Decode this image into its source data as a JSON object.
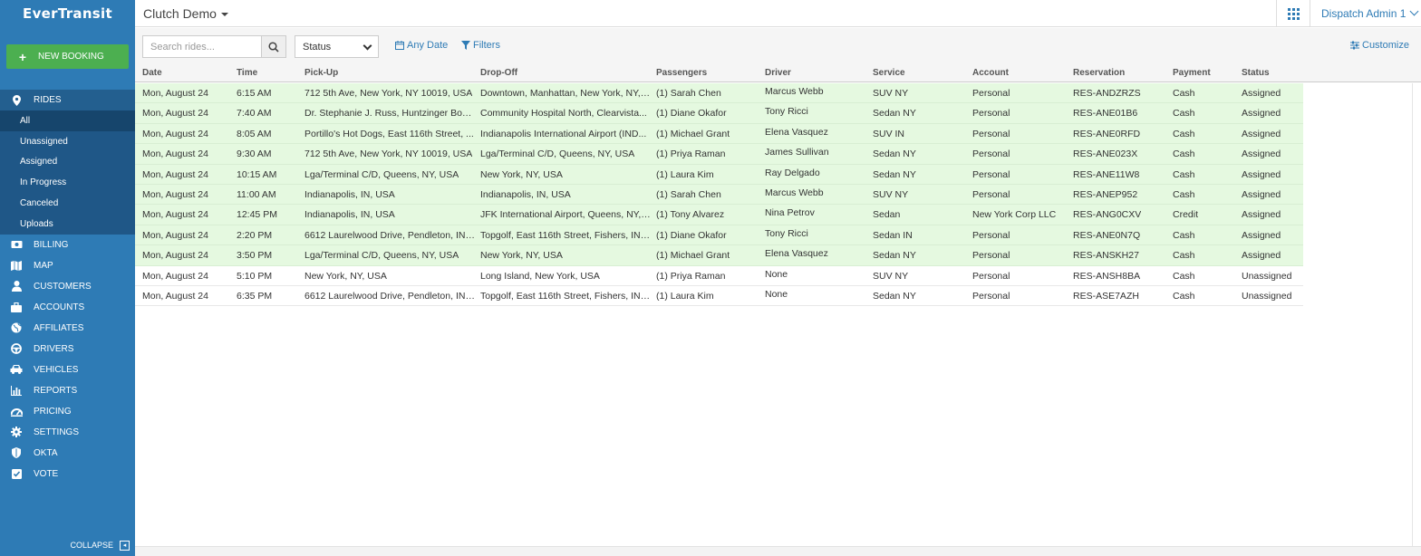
{
  "brand": {
    "logo_text": "EverTransit"
  },
  "sidebar": {
    "new_booking_label": "NEW BOOKING",
    "rides_label": "RIDES",
    "ride_filters": [
      "All",
      "Unassigned",
      "Assigned",
      "In Progress",
      "Canceled",
      "Uploads"
    ],
    "items": [
      {
        "label": "BILLING",
        "icon": "money-icon"
      },
      {
        "label": "MAP",
        "icon": "map-icon"
      },
      {
        "label": "CUSTOMERS",
        "icon": "user-icon"
      },
      {
        "label": "ACCOUNTS",
        "icon": "briefcase-icon"
      },
      {
        "label": "AFFILIATES",
        "icon": "globe-icon"
      },
      {
        "label": "DRIVERS",
        "icon": "steering-wheel-icon"
      },
      {
        "label": "VEHICLES",
        "icon": "car-icon"
      },
      {
        "label": "REPORTS",
        "icon": "bar-chart-icon"
      },
      {
        "label": "PRICING",
        "icon": "dashboard-icon"
      },
      {
        "label": "SETTINGS",
        "icon": "gear-icon"
      },
      {
        "label": "OKTA",
        "icon": "shield-icon"
      },
      {
        "label": "VOTE",
        "icon": "checkbox-icon"
      }
    ],
    "collapse_label": "COLLAPSE"
  },
  "header": {
    "app_title": "Clutch Demo",
    "user_label": "Dispatch Admin 1"
  },
  "toolbar": {
    "search_placeholder": "Search rides...",
    "status_label": "Status",
    "date_label": "Any Date",
    "filters_label": "Filters",
    "customize_label": "Customize"
  },
  "table": {
    "columns": [
      "Date",
      "Time",
      "Pick-Up",
      "Drop-Off",
      "Passengers",
      "Driver",
      "Service",
      "Account",
      "Reservation",
      "Payment",
      "Status"
    ],
    "rows": [
      [
        "Mon, August 24",
        "6:15 AM",
        "712 5th Ave, New York, NY 10019, USA",
        "Downtown, Manhattan, New York, NY, ...",
        "(1) Sarah Chen",
        "Marcus Webb",
        "SUV NY",
        "Personal",
        "RES-ANDZRZS",
        "Cash",
        "Assigned"
      ],
      [
        "Mon, August 24",
        "7:40 AM",
        "Dr. Stephanie J. Russ, Huntzinger Bou...",
        "Community Hospital North, Clearvista...",
        "(1) Diane Okafor",
        "Tony Ricci",
        "Sedan NY",
        "Personal",
        "RES-ANE01B6",
        "Cash",
        "Assigned"
      ],
      [
        "Mon, August 24",
        "8:05 AM",
        "Portillo's Hot Dogs, East 116th Street, ...",
        "Indianapolis International Airport (IND...",
        "(1) Michael Grant",
        "Elena Vasquez",
        "SUV IN",
        "Personal",
        "RES-ANE0RFD",
        "Cash",
        "Assigned"
      ],
      [
        "Mon, August 24",
        "9:30 AM",
        "712 5th Ave, New York, NY 10019, USA",
        "Lga/Terminal C/D, Queens, NY, USA",
        "(1) Priya Raman",
        "James Sullivan",
        "Sedan NY",
        "Personal",
        "RES-ANE023X",
        "Cash",
        "Assigned"
      ],
      [
        "Mon, August 24",
        "10:15 AM",
        "Lga/Terminal C/D, Queens, NY, USA",
        "New York, NY, USA",
        "(1) Laura Kim",
        "Ray Delgado",
        "Sedan NY",
        "Personal",
        "RES-ANE11W8",
        "Cash",
        "Assigned"
      ],
      [
        "Mon, August 24",
        "11:00 AM",
        "Indianapolis, IN, USA",
        "Indianapolis, IN, USA",
        "(1) Sarah Chen",
        "Marcus Webb",
        "SUV NY",
        "Personal",
        "RES-ANEP952",
        "Cash",
        "Assigned"
      ],
      [
        "Mon, August 24",
        "12:45 PM",
        "Indianapolis, IN, USA",
        "JFK International Airport, Queens, NY, ...",
        "(1) Tony Alvarez",
        "Nina Petrov",
        "Sedan",
        "New York Corp LLC",
        "RES-ANG0CXV",
        "Credit",
        "Assigned"
      ],
      [
        "Mon, August 24",
        "2:20 PM",
        "6612 Laurelwood Drive, Pendleton, IN,...",
        "Topgolf, East 116th Street, Fishers, IN,...",
        "(1) Diane Okafor",
        "Tony Ricci",
        "Sedan IN",
        "Personal",
        "RES-ANE0N7Q",
        "Cash",
        "Assigned"
      ],
      [
        "Mon, August 24",
        "3:50 PM",
        "Lga/Terminal C/D, Queens, NY, USA",
        "New York, NY, USA",
        "(1) Michael Grant",
        "Elena Vasquez",
        "Sedan NY",
        "Personal",
        "RES-ANSKH27",
        "Cash",
        "Assigned"
      ],
      [
        "Mon, August 24",
        "5:10 PM",
        "New York, NY, USA",
        "Long Island, New York, USA",
        "(1) Priya Raman",
        "None",
        "SUV NY",
        "Personal",
        "RES-ANSH8BA",
        "Cash",
        "Unassigned"
      ],
      [
        "Mon, August 24",
        "6:35 PM",
        "6612 Laurelwood Drive, Pendleton, IN,...",
        "Topgolf, East 116th Street, Fishers, IN,...",
        "(1) Laura Kim",
        "None",
        "Sedan NY",
        "Personal",
        "RES-ASE7AZH",
        "Cash",
        "Unassigned"
      ]
    ]
  },
  "colors": {
    "sidebar_bg": "#2e7bb5",
    "accent": "#2e7bb5",
    "new_booking": "#4caf50",
    "assigned_row": "#e5f9e0"
  }
}
